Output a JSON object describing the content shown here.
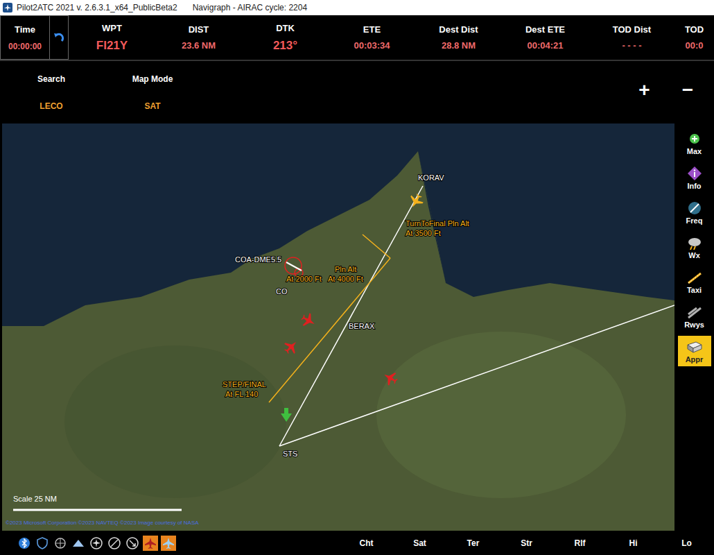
{
  "window": {
    "title": "Pilot2ATC 2021 v. 2.6.3.1_x64_PublicBeta2",
    "subtitle": "Navigraph - AIRAC cycle: 2204"
  },
  "time": {
    "label": "Time",
    "value": "00:00:00"
  },
  "info_fields": [
    {
      "label": "WPT",
      "value": "FI21Y",
      "kind": "large"
    },
    {
      "label": "DIST",
      "value": "23.6 NM",
      "kind": "normal"
    },
    {
      "label": "DTK",
      "value": "213°",
      "kind": "large"
    },
    {
      "label": "ETE",
      "value": "00:03:34",
      "kind": "normal"
    },
    {
      "label": "Dest Dist",
      "value": "28.8 NM",
      "kind": "normal"
    },
    {
      "label": "Dest ETE",
      "value": "00:04:21",
      "kind": "normal"
    },
    {
      "label": "TOD Dist",
      "value": "- - - -",
      "kind": "normal"
    },
    {
      "label": "TOD",
      "value": "00:0",
      "kind": "normal"
    }
  ],
  "search": {
    "label": "Search",
    "value": "LECO"
  },
  "map_mode": {
    "label": "Map Mode",
    "value": "SAT"
  },
  "zoom_buttons": [
    "+",
    "−"
  ],
  "sidebar": [
    {
      "label": "Max",
      "selected": false
    },
    {
      "label": "Info",
      "selected": false
    },
    {
      "label": "Freq",
      "selected": false
    },
    {
      "label": "Wx",
      "selected": false
    },
    {
      "label": "Taxi",
      "selected": false
    },
    {
      "label": "Rwys",
      "selected": false
    },
    {
      "label": "Appr",
      "selected": true
    }
  ],
  "map": {
    "waypoints": [
      "KORAV",
      "BERAX",
      "STS",
      "COA-DME5.5",
      "CO"
    ],
    "annotations": [
      "TurnToFinal Pln Alt",
      "At 3500 Ft",
      "Pln Alt",
      "At 2000 Ft",
      "At 4000 Ft",
      "STEP/FINAL",
      "At FL 140"
    ],
    "aircraft": [
      {
        "color": "#f5b21c"
      },
      {
        "color": "#e02020"
      },
      {
        "color": "#e02020"
      },
      {
        "color": "#e02020"
      }
    ],
    "scale": "Scale 25 NM",
    "attribution": "©2023 Microsoft Corporation ©2023 NAVTEQ ©2023 Image courtesy of NASA"
  },
  "map_filters": [
    {
      "selected": false
    },
    {
      "selected": false
    },
    {
      "selected": false
    },
    {
      "selected": false
    },
    {
      "selected": false
    },
    {
      "selected": false
    },
    {
      "selected": false
    },
    {
      "selected": true
    },
    {
      "selected": true
    }
  ],
  "toolbar": [
    "Cht",
    "Sat",
    "Ter",
    "Str",
    "Rlf",
    "Hi",
    "Lo"
  ]
}
